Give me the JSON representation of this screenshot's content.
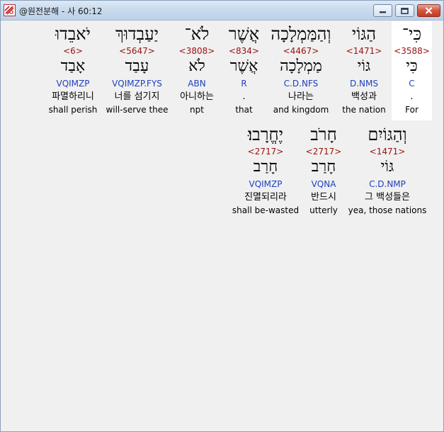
{
  "window": {
    "title": "@원전분해 - 사 60:12"
  },
  "words": [
    {
      "hebrew": "כִּי־",
      "strong": "<3588>",
      "lemma": "כִּי",
      "morph": "C",
      "korean": ".",
      "english": "For"
    },
    {
      "hebrew": "הַגּוֹי",
      "strong": "<1471>",
      "lemma": "גּוֹי",
      "morph": "D.NMS",
      "korean": "백성과",
      "english": "the nation"
    },
    {
      "hebrew": "וְהַמַּמְלָכָה",
      "strong": "<4467>",
      "lemma": "מַמְלָכָה",
      "morph": "C.D.NFS",
      "korean": "나라는",
      "english": "and kingdom"
    },
    {
      "hebrew": "אֲשֶׁר",
      "strong": "<834>",
      "lemma": "אֲשֶׁר",
      "morph": "R",
      "korean": ".",
      "english": "that"
    },
    {
      "hebrew": "לֹא־",
      "strong": "<3808>",
      "lemma": "לֹא",
      "morph": "ABN",
      "korean": "아니하는",
      "english": "npt"
    },
    {
      "hebrew": "יַעַבְדוּךְ",
      "strong": "<5647>",
      "lemma": "עָבַד",
      "morph": "VQIMZP.FYS",
      "korean": "너를 섬기지",
      "english": "will-serve thee"
    },
    {
      "hebrew": "יֹאבֵדוּ",
      "strong": "<6>",
      "lemma": "אָבַד",
      "morph": "VQIMZP",
      "korean": "파멸하리니",
      "english": "shall perish"
    },
    {
      "hebrew": "וְהַגּוֹיִם",
      "strong": "<1471>",
      "lemma": "גּוֹי",
      "morph": "C.D.NMP",
      "korean": "그 백성들은",
      "english": "yea, those nations"
    },
    {
      "hebrew": "חָרֹב",
      "strong": "<2717>",
      "lemma": "חָרַב",
      "morph": "VQNA",
      "korean": "반드시",
      "english": "utterly"
    },
    {
      "hebrew": "יֶחֱרָבוּ׃",
      "strong": "<2717>",
      "lemma": "חָרַב",
      "morph": "VQIMZP",
      "korean": "진멸되리라",
      "english": "shall be-wasted"
    }
  ]
}
